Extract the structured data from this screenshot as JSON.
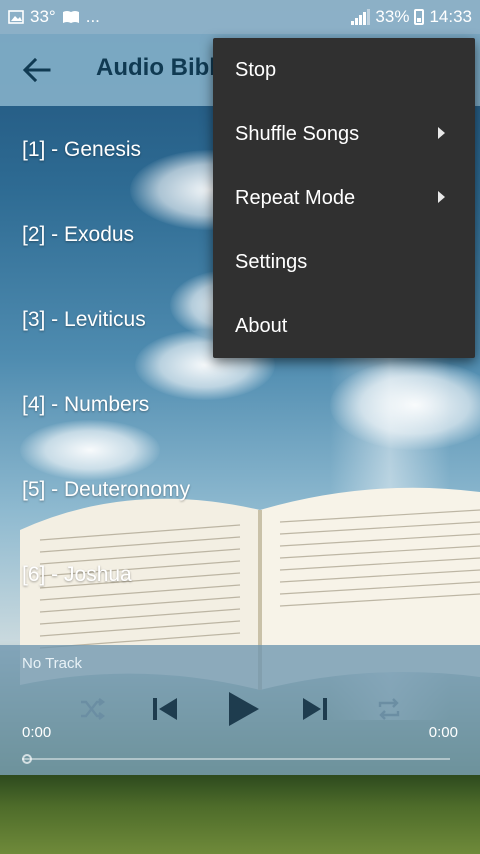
{
  "status_bar": {
    "temperature": "33°",
    "more": "...",
    "battery_percent": "33%",
    "time": "14:33"
  },
  "app_bar": {
    "title": "Audio Bible",
    "back_icon": "arrow-left-icon"
  },
  "list": {
    "items": [
      {
        "label": "[1] - Genesis"
      },
      {
        "label": "[2] - Exodus"
      },
      {
        "label": "[3] - Leviticus"
      },
      {
        "label": "[4] - Numbers"
      },
      {
        "label": "[5] - Deuteronomy"
      },
      {
        "label": "[6] - Joshua"
      }
    ]
  },
  "player": {
    "track": "No Track",
    "elapsed": "0:00",
    "duration": "0:00",
    "progress": 0,
    "icons": [
      "shuffle-icon",
      "skip-previous-icon",
      "play-icon",
      "skip-next-icon",
      "repeat-icon"
    ]
  },
  "menu": {
    "items": [
      {
        "label": "Stop",
        "submenu": false
      },
      {
        "label": "Shuffle Songs",
        "submenu": true
      },
      {
        "label": "Repeat Mode",
        "submenu": true
      },
      {
        "label": "Settings",
        "submenu": false
      },
      {
        "label": "About",
        "submenu": false
      }
    ],
    "background": "#303030"
  }
}
